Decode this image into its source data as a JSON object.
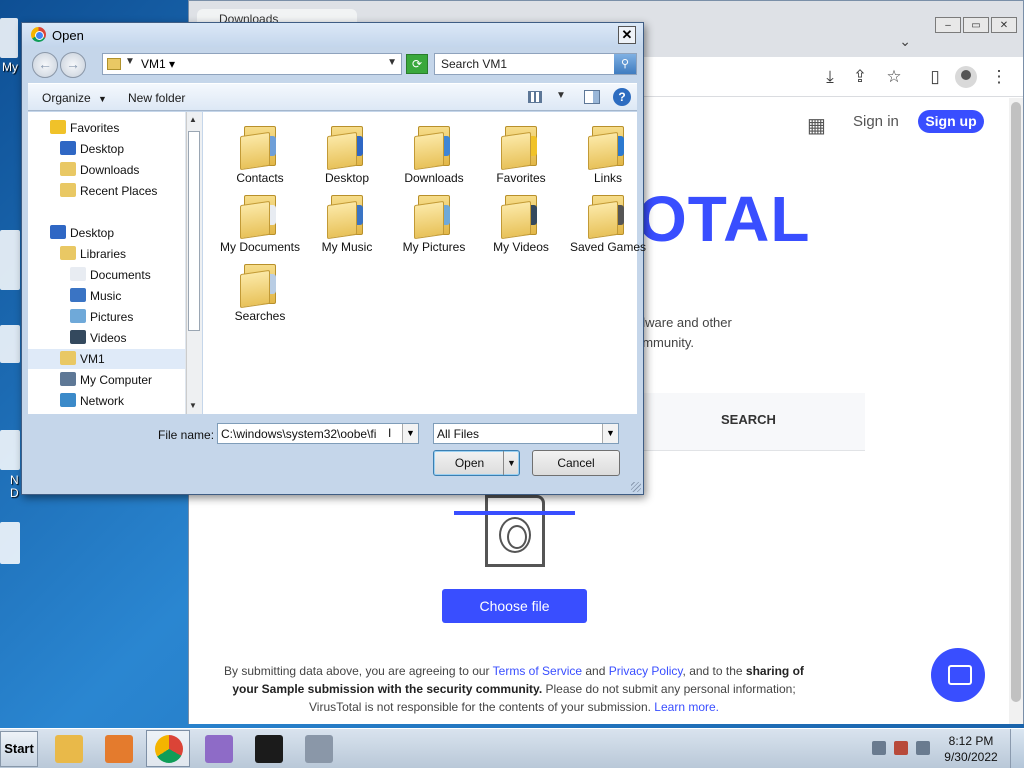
{
  "desktop": {
    "labels": [
      "My",
      "N",
      "D"
    ]
  },
  "browser": {
    "tab_title": "Downloads",
    "window_controls": {
      "minimize": "‒",
      "maximize": "▭",
      "close": "✕"
    },
    "toolbar_icons": [
      "download-icon",
      "share-icon",
      "star-icon",
      "sidepanel-icon",
      "profile-icon",
      "menu-icon"
    ]
  },
  "virustotal": {
    "signin": "Sign in",
    "signup": "Sign up",
    "logo_fragment": "OTAL",
    "desc_line1": "alware and other",
    "desc_line2": "ommunity.",
    "search_tab": "SEARCH",
    "choose_file": "Choose file",
    "legal": {
      "p1": "By submitting data above, you are agreeing to our ",
      "tos": "Terms of Service",
      "and": " and ",
      "privacy": "Privacy Policy",
      "p2": ", and to the ",
      "bold1": "sharing of",
      "bold2": "your Sample submission with the security community.",
      "p3": " Please do not submit any personal information;",
      "p4": "VirusTotal is not responsible for the contents of your submission. ",
      "learn": "Learn more."
    },
    "brand_color": "#394eff"
  },
  "dialog": {
    "title": "Open",
    "close": "✕",
    "address": {
      "location": "VM1"
    },
    "search_placeholder": "Search VM1",
    "commands": {
      "organize": "Organize",
      "new_folder": "New folder",
      "help": "?"
    },
    "nav": [
      {
        "label": "Favorites",
        "icon": "star-icon"
      },
      {
        "label": "Desktop",
        "icon": "desktop-icon"
      },
      {
        "label": "Downloads",
        "icon": "downloads-folder-icon"
      },
      {
        "label": "Recent Places",
        "icon": "recent-places-icon"
      },
      {
        "label": "Desktop",
        "icon": "desktop-icon"
      },
      {
        "label": "Libraries",
        "icon": "libraries-icon"
      },
      {
        "label": "Documents",
        "icon": "documents-icon"
      },
      {
        "label": "Music",
        "icon": "music-icon"
      },
      {
        "label": "Pictures",
        "icon": "pictures-icon"
      },
      {
        "label": "Videos",
        "icon": "videos-icon"
      },
      {
        "label": "VM1",
        "icon": "user-folder-icon"
      },
      {
        "label": "My Computer",
        "icon": "computer-icon"
      },
      {
        "label": "Network",
        "icon": "network-icon"
      }
    ],
    "folders": [
      {
        "label": "Contacts",
        "badge": "#6f9fd8"
      },
      {
        "label": "Desktop",
        "badge": "#2f67c4"
      },
      {
        "label": "Downloads",
        "badge": "#3f86d6"
      },
      {
        "label": "Favorites",
        "badge": "#f0c229"
      },
      {
        "label": "Links",
        "badge": "#2c79cf"
      },
      {
        "label": "My Documents",
        "badge": "#e8ecf2"
      },
      {
        "label": "My Music",
        "badge": "#3a74c4"
      },
      {
        "label": "My Pictures",
        "badge": "#6fa9d9"
      },
      {
        "label": "My Videos",
        "badge": "#34495e"
      },
      {
        "label": "Saved Games",
        "badge": "#555555"
      },
      {
        "label": "Searches",
        "badge": "#b9cde4"
      }
    ],
    "file_name_label": "File name:",
    "file_name_value": "C:\\windows\\system32\\oobe\\fi",
    "file_type": "All Files",
    "open_button": "Open",
    "cancel_button": "Cancel"
  },
  "taskbar": {
    "start": "Start",
    "apps": [
      {
        "name": "explorer-icon",
        "color": "#e9b949",
        "active": false
      },
      {
        "name": "media-player-icon",
        "color": "#e47b2d",
        "active": false
      },
      {
        "name": "chrome-icon",
        "color": "#4285f4",
        "active": true
      },
      {
        "name": "paint-icon",
        "color": "#8e6bc7",
        "active": false
      },
      {
        "name": "cmd-icon",
        "color": "#1b1b1b",
        "active": false
      },
      {
        "name": "installer-icon",
        "color": "#8a97a8",
        "active": false
      }
    ],
    "clock_time": "8:12 PM",
    "clock_date": "9/30/2022"
  }
}
